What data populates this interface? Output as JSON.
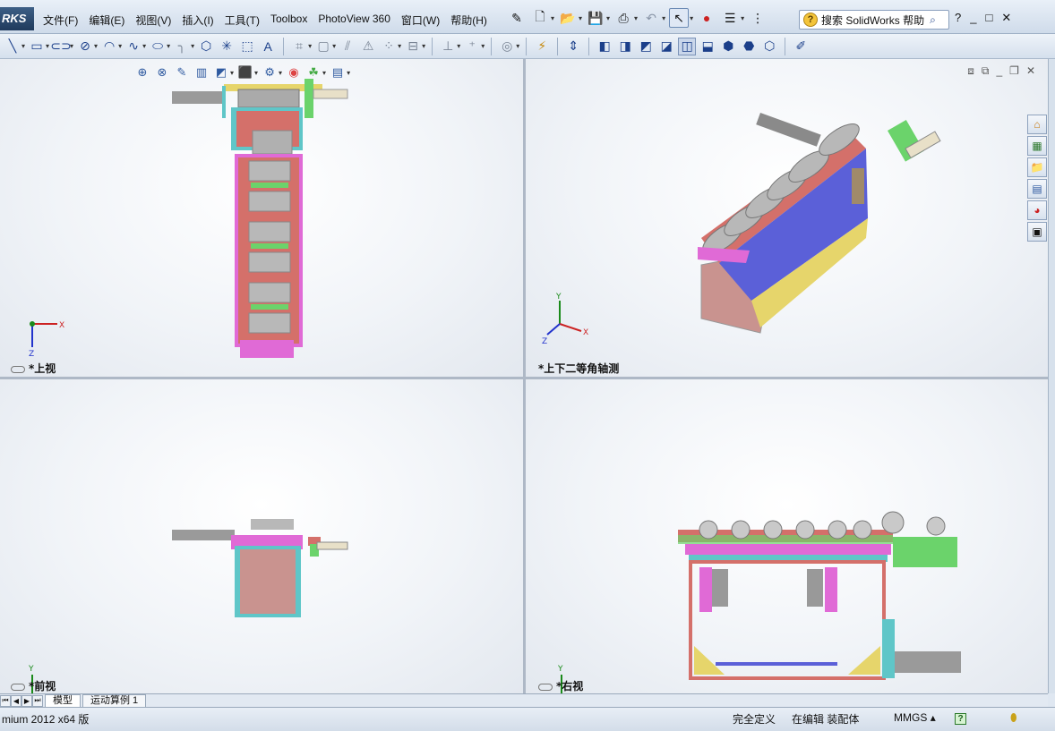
{
  "app": {
    "brand": "RKS",
    "version_text": "mium 2012 x64 版"
  },
  "menu": [
    "文件(F)",
    "编辑(E)",
    "视图(V)",
    "插入(I)",
    "工具(T)",
    "Toolbox",
    "PhotoView 360",
    "窗口(W)",
    "帮助(H)"
  ],
  "search": {
    "placeholder": "搜索 SolidWorks 帮助",
    "icon": "help-question-icon"
  },
  "window_controls": [
    "?",
    "_",
    "□",
    "✕"
  ],
  "viewports": {
    "top_left": {
      "label": "*上视"
    },
    "top_right": {
      "label": "*上下二等角轴测"
    },
    "bottom_left": {
      "label": "*前视"
    },
    "bottom_right": {
      "label": "*右视"
    }
  },
  "axes": {
    "x": "X",
    "y": "Y",
    "z": "Z"
  },
  "tabs": [
    {
      "label": "模型",
      "active": true
    },
    {
      "label": "运动算例 1",
      "active": false
    }
  ],
  "status": {
    "definition": "完全定义",
    "editing": "在编辑 装配体",
    "units": "MMGS",
    "units_arrow": "▴",
    "help": "?"
  },
  "colors": {
    "frame_red": "#d4706a",
    "frame_cyan": "#5fc6c8",
    "accent_magenta": "#e06ad6",
    "roller_grey": "#a9a9a9",
    "accent_green": "#6bd36b",
    "accent_blue": "#5b60d8",
    "accent_yellow": "#e6d56b"
  }
}
